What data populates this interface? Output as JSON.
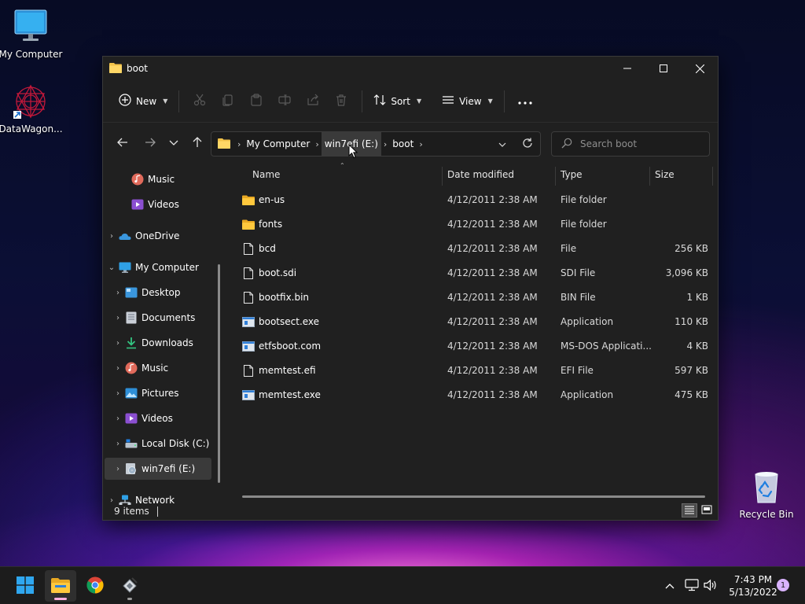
{
  "desktop": {
    "icons": [
      {
        "label": "My Computer"
      },
      {
        "label": "DataWagon..."
      },
      {
        "label": "Recycle Bin"
      }
    ]
  },
  "window": {
    "title": "boot",
    "toolbar": {
      "new_label": "New",
      "sort_label": "Sort",
      "view_label": "View"
    },
    "address": {
      "crumbs": [
        "My Computer",
        "win7efi (E:)",
        "boot"
      ]
    },
    "search": {
      "placeholder": "Search boot"
    },
    "nav_pane": {
      "items": [
        {
          "label": "Music",
          "icon": "music-icon"
        },
        {
          "label": "Videos",
          "icon": "videos-icon"
        },
        {
          "label": "OneDrive",
          "icon": "onedrive-icon"
        },
        {
          "label": "My Computer",
          "icon": "computer-icon"
        },
        {
          "label": "Desktop",
          "icon": "desktop-icon"
        },
        {
          "label": "Documents",
          "icon": "documents-icon"
        },
        {
          "label": "Downloads",
          "icon": "downloads-icon"
        },
        {
          "label": "Music",
          "icon": "music-icon"
        },
        {
          "label": "Pictures",
          "icon": "pictures-icon"
        },
        {
          "label": "Videos",
          "icon": "videos-icon"
        },
        {
          "label": "Local Disk (C:)",
          "icon": "drive-icon"
        },
        {
          "label": "win7efi (E:)",
          "icon": "disc-drive-icon"
        },
        {
          "label": "Network",
          "icon": "network-icon"
        }
      ]
    },
    "columns": {
      "name": "Name",
      "date": "Date modified",
      "type": "Type",
      "size": "Size"
    },
    "files": [
      {
        "name": "en-us",
        "date": "4/12/2011 2:38 AM",
        "type": "File folder",
        "size": "",
        "icon": "folder-icon"
      },
      {
        "name": "fonts",
        "date": "4/12/2011 2:38 AM",
        "type": "File folder",
        "size": "",
        "icon": "folder-icon"
      },
      {
        "name": "bcd",
        "date": "4/12/2011 2:38 AM",
        "type": "File",
        "size": "256 KB",
        "icon": "file-icon"
      },
      {
        "name": "boot.sdi",
        "date": "4/12/2011 2:38 AM",
        "type": "SDI File",
        "size": "3,096 KB",
        "icon": "file-icon"
      },
      {
        "name": "bootfix.bin",
        "date": "4/12/2011 2:38 AM",
        "type": "BIN File",
        "size": "1 KB",
        "icon": "file-icon"
      },
      {
        "name": "bootsect.exe",
        "date": "4/12/2011 2:38 AM",
        "type": "Application",
        "size": "110 KB",
        "icon": "exe-icon"
      },
      {
        "name": "etfsboot.com",
        "date": "4/12/2011 2:38 AM",
        "type": "MS-DOS Applicati...",
        "size": "4 KB",
        "icon": "exe-icon"
      },
      {
        "name": "memtest.efi",
        "date": "4/12/2011 2:38 AM",
        "type": "EFI File",
        "size": "597 KB",
        "icon": "file-icon"
      },
      {
        "name": "memtest.exe",
        "date": "4/12/2011 2:38 AM",
        "type": "Application",
        "size": "475 KB",
        "icon": "exe-icon"
      }
    ],
    "status": {
      "item_count": "9 items"
    }
  },
  "taskbar": {
    "time": "7:43 PM",
    "date": "5/13/2022",
    "notification_count": "1"
  },
  "colors": {
    "folder": "#f3c34a",
    "accent": "#4cc2ff",
    "window_bg": "#202020",
    "taskbar_bg": "#1c1c1c"
  }
}
